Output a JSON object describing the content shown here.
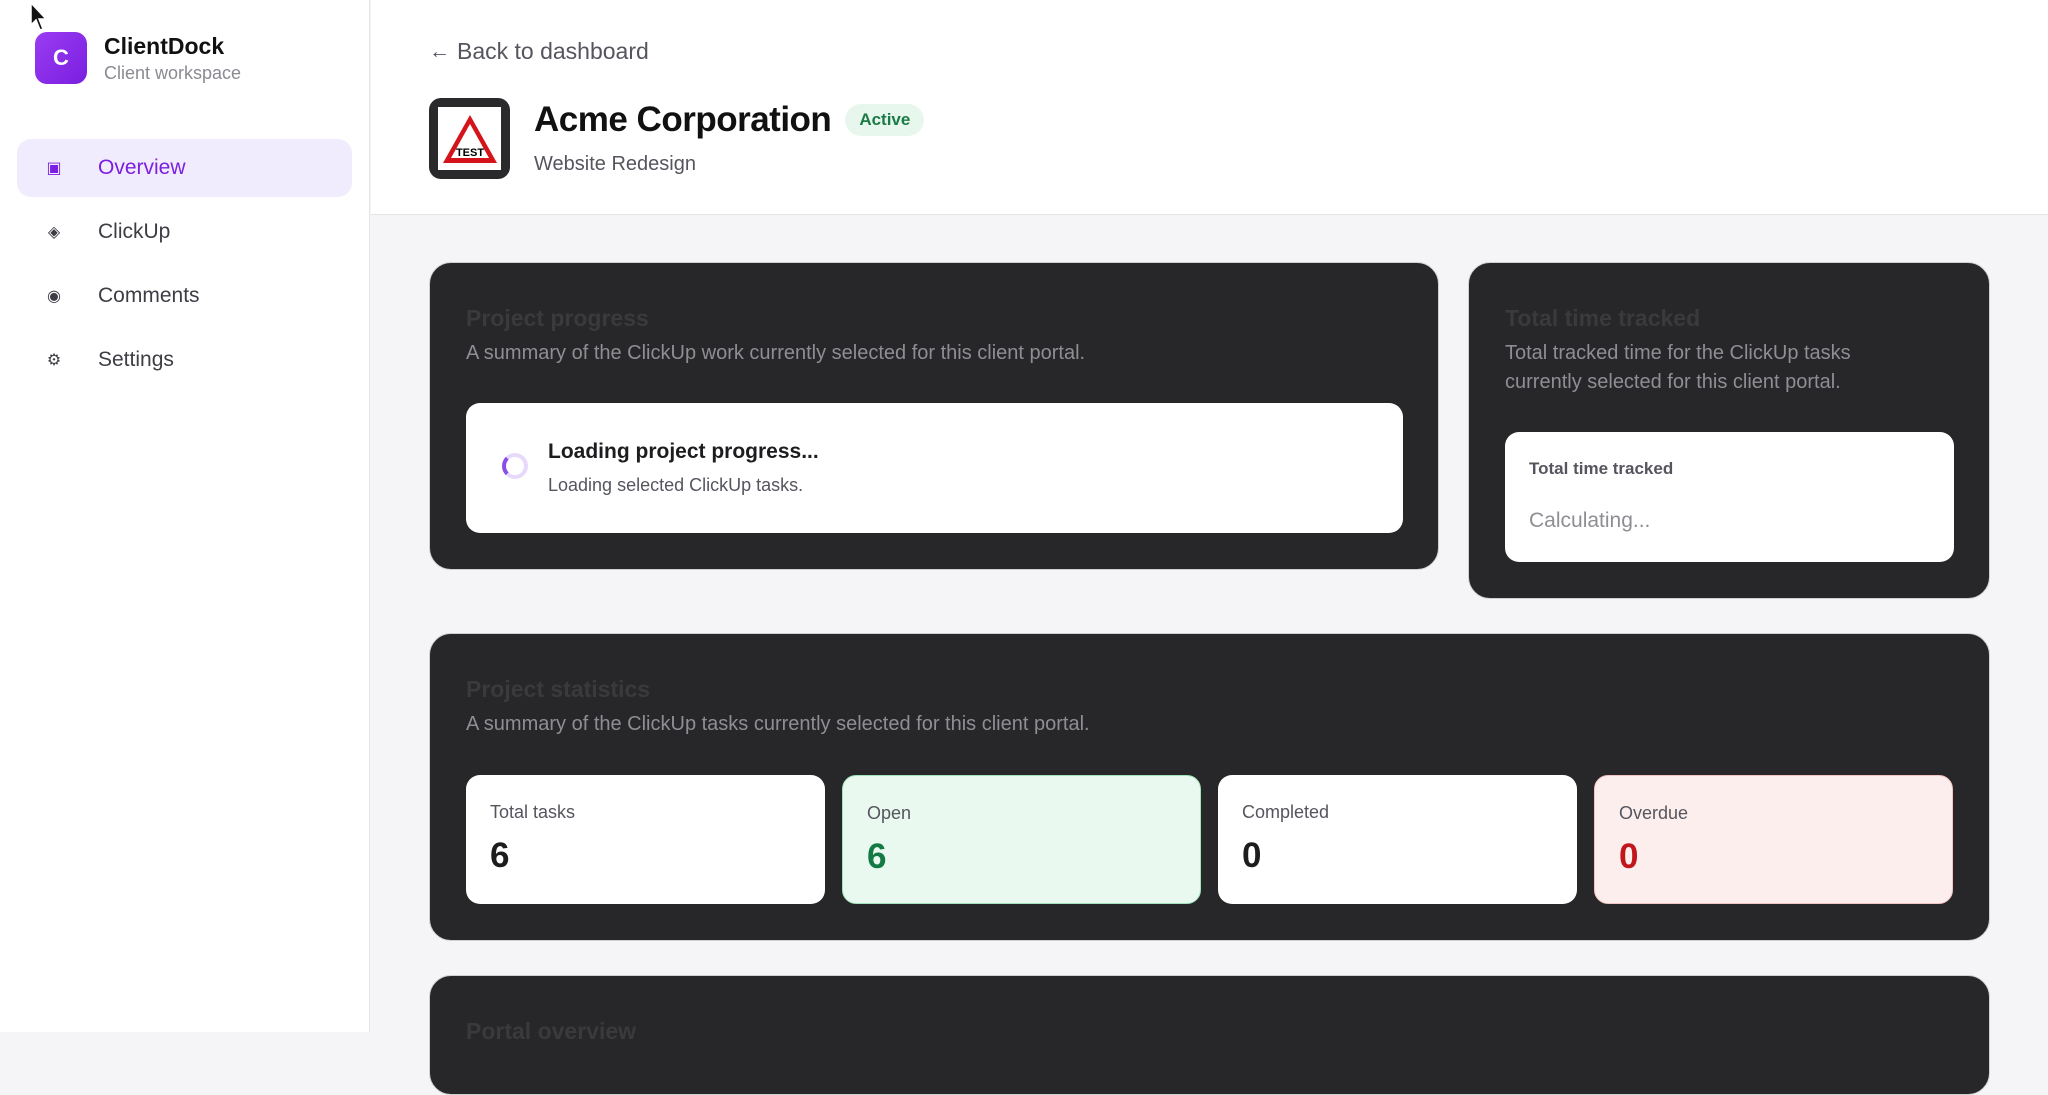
{
  "brand": {
    "initial": "C",
    "name": "ClientDock",
    "subtitle": "Client workspace"
  },
  "sidebar": {
    "items": [
      {
        "label": "Overview",
        "icon": "square-icon",
        "glyph": "▣",
        "active": true
      },
      {
        "label": "ClickUp",
        "icon": "diamond-icon",
        "glyph": "◈",
        "active": false
      },
      {
        "label": "Comments",
        "icon": "circle-icon",
        "glyph": "◉",
        "active": false
      },
      {
        "label": "Settings",
        "icon": "gear-icon",
        "glyph": "⚙",
        "active": false
      }
    ]
  },
  "header": {
    "back_label": "Back to dashboard",
    "title": "Acme Corporation",
    "status": "Active",
    "project": "Website Redesign",
    "logo_text": "TEST"
  },
  "progress_panel": {
    "title": "Project progress",
    "description": "A summary of the ClickUp work currently selected for this client portal.",
    "loading_title": "Loading project progress...",
    "loading_sub": "Loading selected ClickUp tasks."
  },
  "time_panel": {
    "title": "Total time tracked",
    "description_line1": "Total tracked time for the ClickUp tasks",
    "description_line2": "currently selected for this client portal.",
    "box_label": "Total time tracked",
    "box_value": "Calculating..."
  },
  "stats_panel": {
    "title": "Project statistics",
    "description": "A summary of the ClickUp tasks currently selected for this client portal.",
    "stats": [
      {
        "label": "Total tasks",
        "value": "6"
      },
      {
        "label": "Open",
        "value": "6"
      },
      {
        "label": "Completed",
        "value": "0"
      },
      {
        "label": "Overdue",
        "value": "0"
      }
    ]
  },
  "overview_panel": {
    "title": "Portal overview"
  },
  "colors": {
    "accent": "#7b1fe0",
    "active_green": "#1b7a45",
    "overdue_red": "#c0161c",
    "panel_bg": "#272729"
  }
}
